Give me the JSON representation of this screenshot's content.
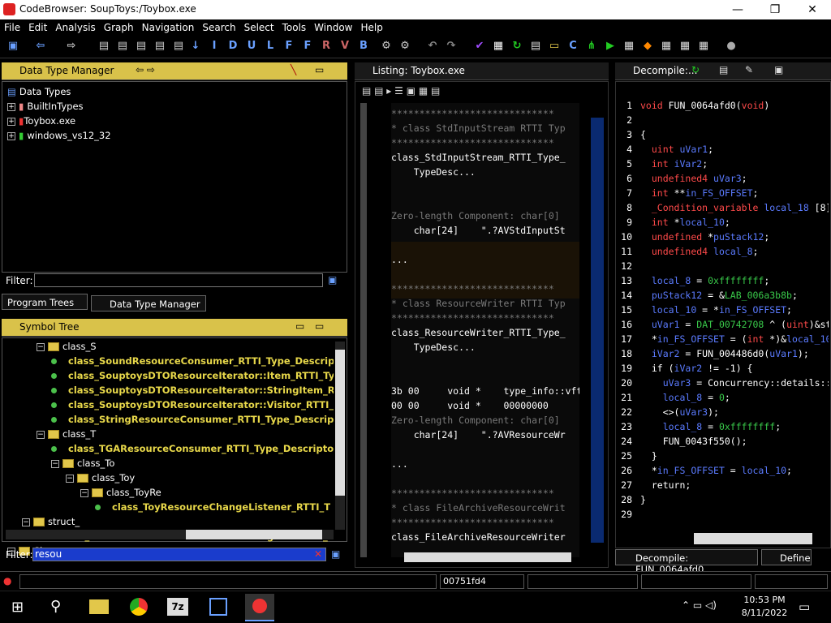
{
  "window": {
    "title": "CodeBrowser: SoupToys:/Toybox.exe",
    "min": "—",
    "max": "❐",
    "close": "✕"
  },
  "menu": [
    "File",
    "Edit",
    "Analysis",
    "Graph",
    "Navigation",
    "Search",
    "Select",
    "Tools",
    "Window",
    "Help"
  ],
  "dtm": {
    "title": "Data Type Manager",
    "root": "Data Types",
    "items": [
      "BuiltInTypes",
      "Toybox.exe",
      "windows_vs12_32"
    ],
    "filter_label": "Filter:"
  },
  "tabs_left": {
    "program_trees": "Program Trees",
    "dtm": "Data Type Manager"
  },
  "symbol_tree": {
    "title": "Symbol Tree",
    "filter_label": "Filter:",
    "filter_value": "resou",
    "rows": [
      {
        "t": "class_S",
        "k": "folder",
        "d": 2
      },
      {
        "t": "class_SoundResourceConsumer_RTTI_Type_Descript",
        "k": "leaf",
        "d": 3
      },
      {
        "t": "class_SouptoysDTOResourceIterator::Item_RTTI_Typ",
        "k": "leaf",
        "d": 3
      },
      {
        "t": "class_SouptoysDTOResourceIterator::StringItem_RTT",
        "k": "leaf",
        "d": 3
      },
      {
        "t": "class_SouptoysDTOResourceIterator::Visitor_RTTI_T",
        "k": "leaf",
        "d": 3
      },
      {
        "t": "class_StringResourceConsumer_RTTI_Type_Descript",
        "k": "leaf",
        "d": 3
      },
      {
        "t": "class_T",
        "k": "folder",
        "d": 2
      },
      {
        "t": "class_TGAResourceConsumer_RTTI_Type_Descriptor",
        "k": "leaf",
        "d": 3
      },
      {
        "t": "class_To",
        "k": "folder",
        "d": 3
      },
      {
        "t": "class_Toy",
        "k": "folder",
        "d": 4
      },
      {
        "t": "class_ToyRe",
        "k": "folder",
        "d": 5
      },
      {
        "t": "class_ToyResourceChangeListener_RTTI_T",
        "k": "leaf",
        "d": 6
      },
      {
        "t": "struct_",
        "k": "folder",
        "d": 1
      },
      {
        "t": "struct_FileArchiveResourceLoader::ChangeListener_RTTI",
        "k": "leaf",
        "d": 2
      },
      {
        "t": "Classes",
        "k": "folder",
        "d": 0
      }
    ]
  },
  "listing": {
    "title": "Listing:  Toybox.exe",
    "lines": [
      {
        "c": "gray",
        "t": "*****************************"
      },
      {
        "c": "gray",
        "t": "* class StdInputStream RTTI Typ"
      },
      {
        "c": "gray",
        "t": "*****************************"
      },
      {
        "c": "w",
        "t": "class_StdInputStream_RTTI_Type_"
      },
      {
        "c": "w",
        "t": "    TypeDesc..."
      },
      {
        "c": "w",
        "t": ""
      },
      {
        "c": "w",
        "t": ""
      },
      {
        "c": "gray",
        "t": "Zero-length Component: char[0]"
      },
      {
        "c": "w",
        "t": "    char[24]    \".?AVStdInputSt"
      },
      {
        "c": "w",
        "t": ""
      },
      {
        "c": "w",
        "t": "..."
      },
      {
        "c": "w",
        "t": ""
      },
      {
        "c": "gray",
        "t": "*****************************"
      },
      {
        "c": "gray",
        "t": "* class ResourceWriter RTTI Typ"
      },
      {
        "c": "gray",
        "t": "*****************************"
      },
      {
        "c": "w",
        "t": "class_ResourceWriter_RTTI_Type_"
      },
      {
        "c": "w",
        "t": "    TypeDesc..."
      },
      {
        "c": "w",
        "t": ""
      },
      {
        "c": "w",
        "t": ""
      },
      {
        "c": "w",
        "t": "3b 00     void *    type_info::vft"
      },
      {
        "c": "w",
        "t": "00 00     void *    00000000"
      },
      {
        "c": "gray",
        "t": "Zero-length Component: char[0]"
      },
      {
        "c": "w",
        "t": "    char[24]    \".?AVResourceWr"
      },
      {
        "c": "w",
        "t": ""
      },
      {
        "c": "w",
        "t": "..."
      },
      {
        "c": "w",
        "t": ""
      },
      {
        "c": "gray",
        "t": "*****************************"
      },
      {
        "c": "gray",
        "t": "* class FileArchiveResourceWrit"
      },
      {
        "c": "gray",
        "t": "*****************************"
      },
      {
        "c": "w",
        "t": "class_FileArchiveResourceWriter"
      }
    ]
  },
  "decompile": {
    "title": "Decompile:...",
    "tab": "Decompile: FUN_0064afd0",
    "tab2": "Define",
    "lines": [
      "void FUN_0064afd0(void)",
      "",
      "{",
      "  uint uVar1;",
      "  int iVar2;",
      "  undefined4 uVar3;",
      "  int **in_FS_OFFSET;",
      "  _Condition_variable local_18 [8]",
      "  int *local_10;",
      "  undefined *puStack12;",
      "  undefined4 local_8;",
      "",
      "  local_8 = 0xffffffff;",
      "  puStack12 = &LAB_006a3b8b;",
      "  local_10 = *in_FS_OFFSET;",
      "  uVar1 = DAT_00742708 ^ (uint)&st",
      "  *in_FS_OFFSET = (int *)&local_10",
      "  iVar2 = FUN_004486d0(uVar1);",
      "  if (iVar2 != -1) {",
      "    uVar3 = Concurrency::details::",
      "    local_8 = 0;",
      "    <>(uVar3);",
      "    local_8 = 0xffffffff;",
      "    FUN_0043f550();",
      "  }",
      "  *in_FS_OFFSET = local_10;",
      "  return;",
      "}",
      ""
    ]
  },
  "status": {
    "address": "00751fd4"
  },
  "taskbar": {
    "time": "10:53 PM",
    "date": "8/11/2022"
  }
}
